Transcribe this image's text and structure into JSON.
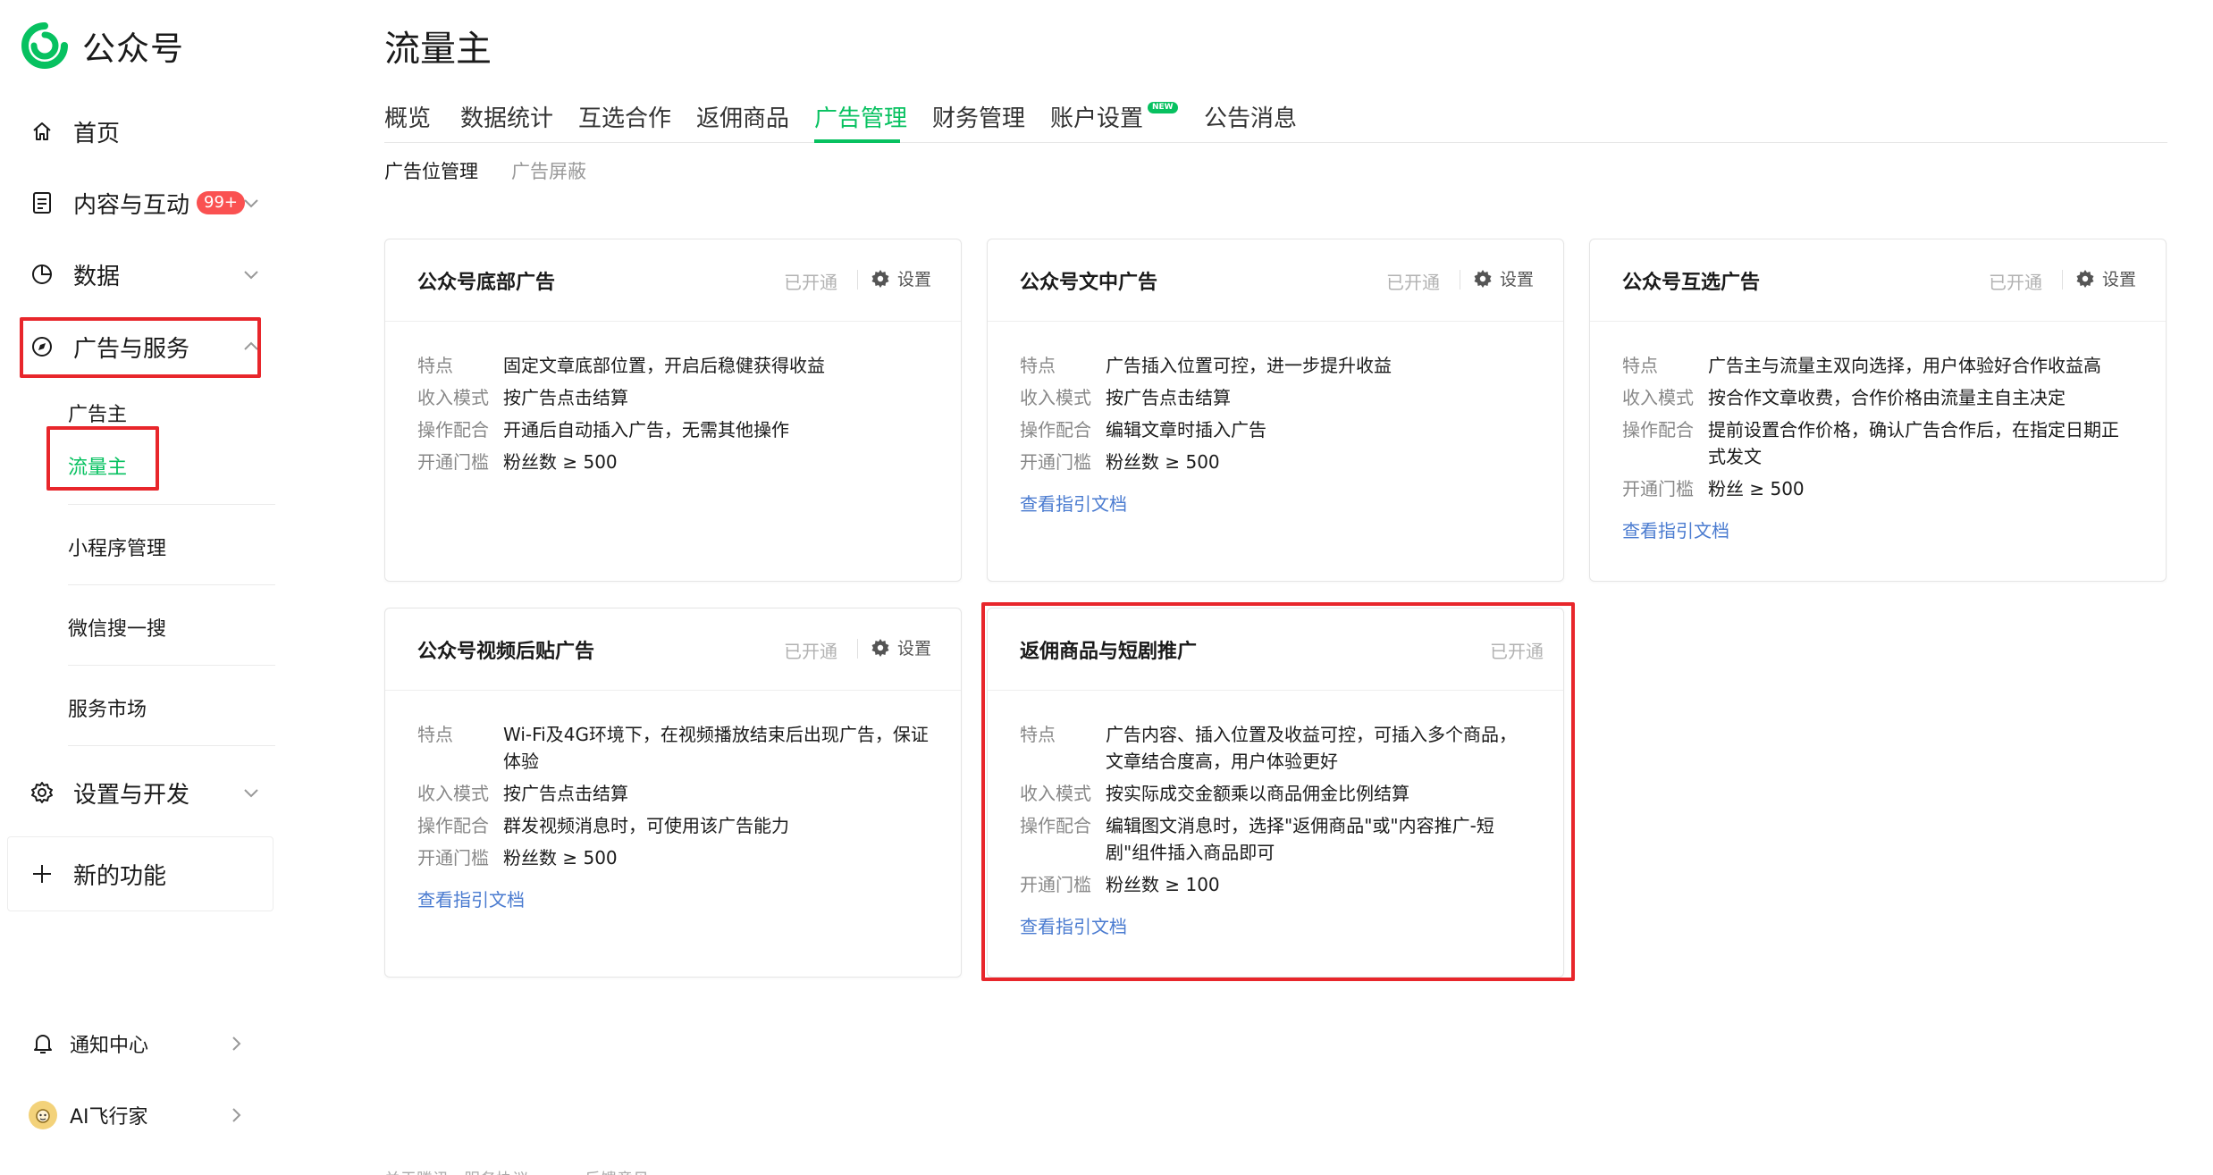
{
  "app": {
    "name": "公众号",
    "brand_color": "#07c160",
    "alert_color": "#fa5151",
    "highlight_color": "#e8262b"
  },
  "sidebar": {
    "items": [
      {
        "label": "首页",
        "icon": "home-icon"
      },
      {
        "label": "内容与互动",
        "icon": "document-icon",
        "badge": "99+"
      },
      {
        "label": "数据",
        "icon": "pie-chart-icon"
      },
      {
        "label": "广告与服务",
        "icon": "compass-icon"
      },
      {
        "label": "设置与开发",
        "icon": "gear-icon"
      },
      {
        "label": "新的功能",
        "icon": "plus-icon"
      }
    ],
    "sub_items": [
      "广告主",
      "流量主",
      "小程序管理",
      "微信搜一搜",
      "服务市场"
    ],
    "bottom": [
      {
        "label": "通知中心",
        "icon": "bell-icon"
      },
      {
        "label": "AI飞行家",
        "icon": "avatar"
      }
    ]
  },
  "page": {
    "title": "流量主"
  },
  "tabs": [
    "概览",
    "数据统计",
    "互选合作",
    "返佣商品",
    "广告管理",
    "财务管理",
    "账户设置",
    "公告消息"
  ],
  "active_tab": "广告管理",
  "new_tag": "NEW",
  "subtabs": [
    "广告位管理",
    "广告屏蔽"
  ],
  "labels": {
    "status": "已开通",
    "setting": "设置",
    "doc_link": "查看指引文档",
    "footer_partial": "关于腾讯  ·  服务协议  ·  ·  ·  ·  ·  反馈意见"
  },
  "cards": [
    {
      "title": "公众号底部广告",
      "rows": [
        {
          "k": "特点",
          "v": "固定文章底部位置，开启后稳健获得收益"
        },
        {
          "k": "收入模式",
          "v": "按广告点击结算"
        },
        {
          "k": "操作配合",
          "v": "开通后自动插入广告，无需其他操作"
        },
        {
          "k": "开通门槛",
          "v": "粉丝数 ≥ 500"
        }
      ]
    },
    {
      "title": "公众号文中广告",
      "rows": [
        {
          "k": "特点",
          "v": "广告插入位置可控，进一步提升收益"
        },
        {
          "k": "收入模式",
          "v": "按广告点击结算"
        },
        {
          "k": "操作配合",
          "v": "编辑文章时插入广告"
        },
        {
          "k": "开通门槛",
          "v": "粉丝数 ≥ 500"
        }
      ]
    },
    {
      "title": "公众号互选广告",
      "rows": [
        {
          "k": "特点",
          "v": "广告主与流量主双向选择，用户体验好合作收益高"
        },
        {
          "k": "收入模式",
          "v": "按合作文章收费，合作价格由流量主自主决定"
        },
        {
          "k": "操作配合",
          "v": "提前设置合作价格，确认广告合作后，在指定日期正式发文"
        },
        {
          "k": "开通门槛",
          "v": "粉丝 ≥ 500"
        }
      ]
    },
    {
      "title": "公众号视频后贴广告",
      "rows": [
        {
          "k": "特点",
          "v": "Wi-Fi及4G环境下，在视频播放结束后出现广告，保证体验"
        },
        {
          "k": "收入模式",
          "v": "按广告点击结算"
        },
        {
          "k": "操作配合",
          "v": "群发视频消息时，可使用该广告能力"
        },
        {
          "k": "开通门槛",
          "v": "粉丝数 ≥ 500"
        }
      ]
    },
    {
      "title": "返佣商品与短剧推广",
      "rows": [
        {
          "k": "特点",
          "v": "广告内容、插入位置及收益可控，可插入多个商品，文章结合度高，用户体验更好"
        },
        {
          "k": "收入模式",
          "v": "按实际成交金额乘以商品佣金比例结算"
        },
        {
          "k": "操作配合",
          "v": "编辑图文消息时，选择\"返佣商品\"或\"内容推广-短剧\"组件插入商品即可"
        },
        {
          "k": "开通门槛",
          "v": "粉丝数 ≥ 100"
        }
      ]
    }
  ]
}
